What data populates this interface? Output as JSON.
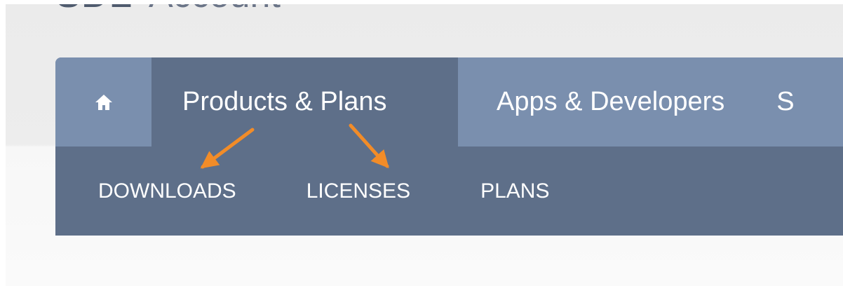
{
  "header": {
    "brand_mark": "SDL",
    "title": "Account"
  },
  "nav": {
    "home_icon": "home-icon",
    "tabs": [
      {
        "label": "Products & Plans",
        "active": true
      },
      {
        "label": "Apps & Developers",
        "active": false
      },
      {
        "label": "S",
        "active": false
      }
    ],
    "subnav": [
      {
        "label": "DOWNLOADS"
      },
      {
        "label": "LICENSES"
      },
      {
        "label": "PLANS"
      }
    ]
  },
  "annotations": {
    "arrow_color": "#f28c28",
    "arrows": [
      "arrow-to-downloads",
      "arrow-to-licenses"
    ]
  },
  "colors": {
    "tab_bar": "#7a8fae",
    "active_tab": "#5e6f89",
    "subnav": "#5e6f89",
    "page_background": "#ededed"
  }
}
